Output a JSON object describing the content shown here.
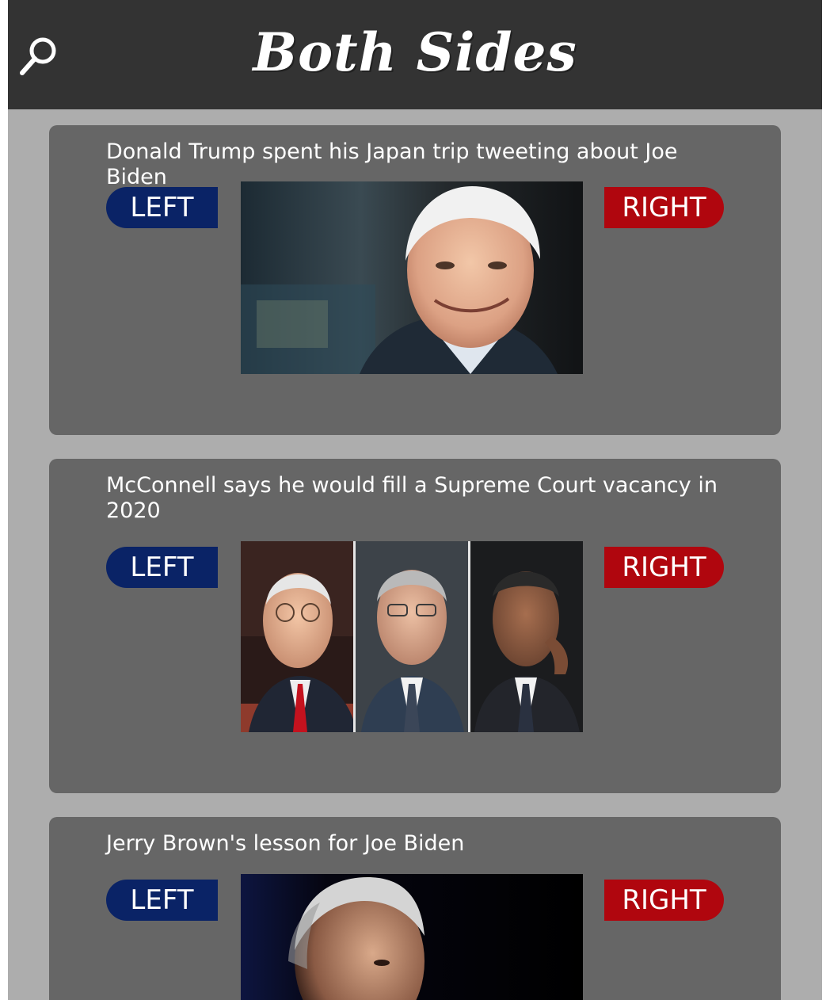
{
  "app": {
    "title": "Both Sides"
  },
  "header": {
    "search_icon": "search-icon"
  },
  "colors": {
    "header_bg": "#333333",
    "page_bg": "#adadad",
    "card_bg": "#666666",
    "left_pill": "#0a2366",
    "right_pill": "#b0060e"
  },
  "articles": [
    {
      "headline": "Donald Trump spent his Japan trip tweeting about Joe Biden",
      "left_label": "LEFT",
      "right_label": "RIGHT"
    },
    {
      "headline": "McConnell says he would fill a Supreme Court vacancy in 2020",
      "left_label": "LEFT",
      "right_label": "RIGHT"
    },
    {
      "headline": "Jerry Brown's lesson for Joe Biden",
      "left_label": "LEFT",
      "right_label": "RIGHT"
    }
  ]
}
